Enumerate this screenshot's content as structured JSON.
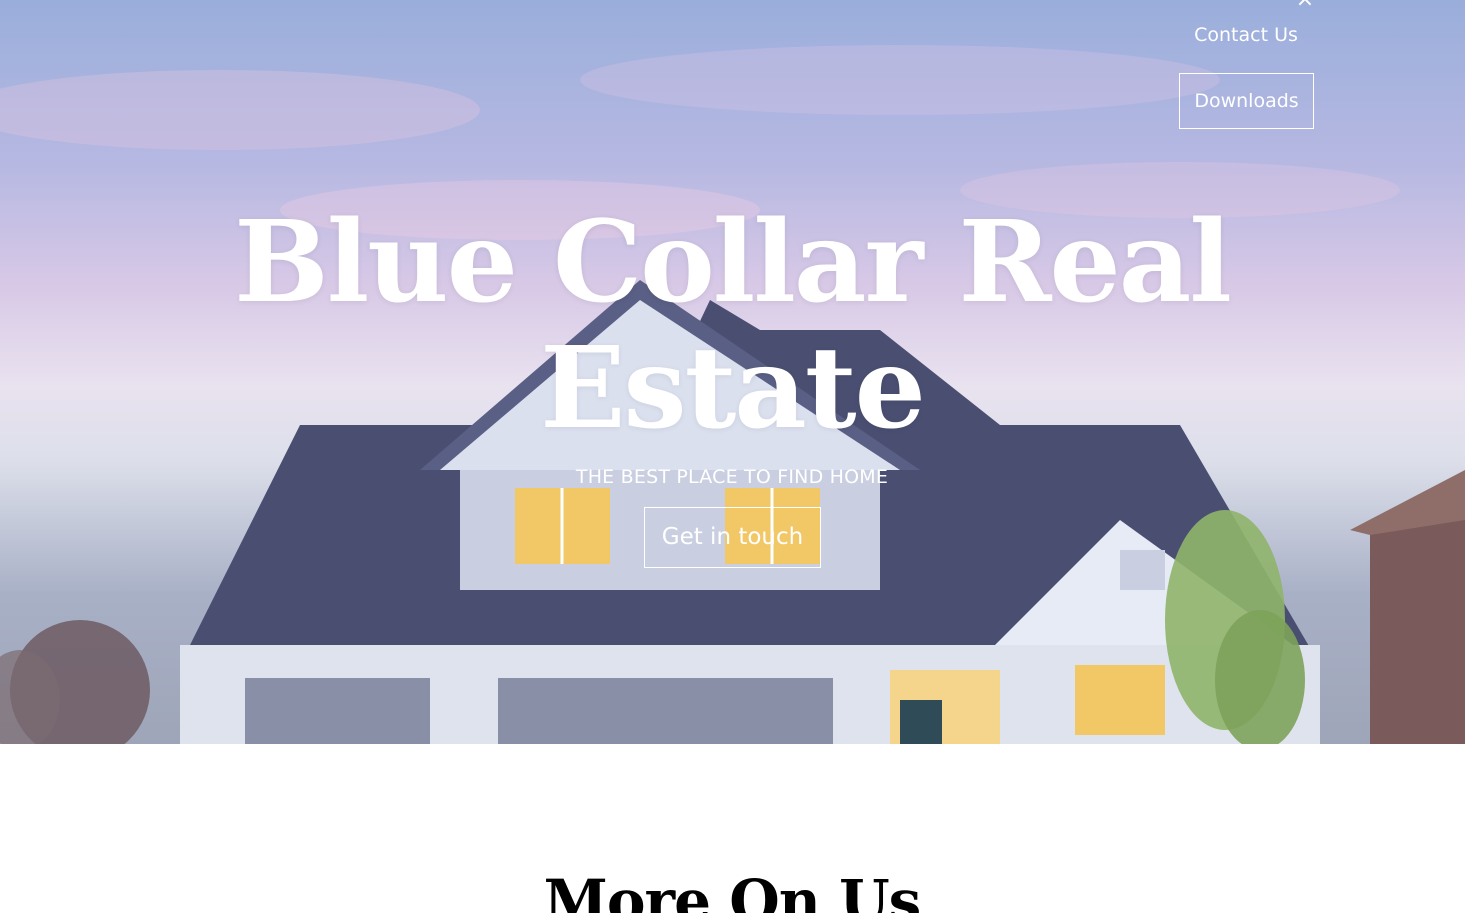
{
  "nav": {
    "close_icon": "×",
    "contact_label": "Contact Us",
    "downloads_label": "Downloads"
  },
  "hero": {
    "title": "Blue Collar Real Estate",
    "subtitle": "THE BEST PLACE TO FIND HOME",
    "cta_label": "Get in touch",
    "image_subject": "suburban-house-at-dusk"
  },
  "section": {
    "heading": "More On Us"
  },
  "colors": {
    "hero_text": "#ffffff",
    "body_background": "#ffffff",
    "section_heading": "#000000",
    "roof": "#4a4f72",
    "siding": "#c9cfe0",
    "window_light": "#f2c766"
  }
}
